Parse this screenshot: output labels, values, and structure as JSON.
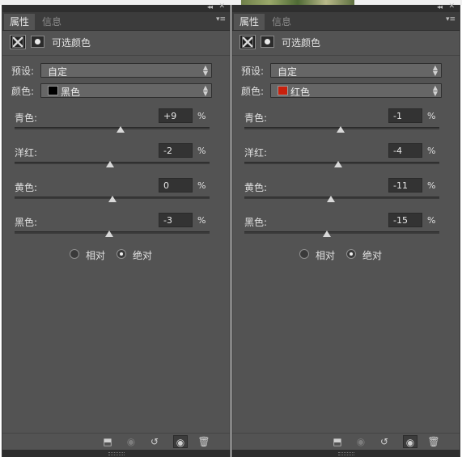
{
  "panels": [
    {
      "tabs": {
        "active": "属性",
        "inactive": "信息"
      },
      "window_controls": {
        "collapse": "◂◂",
        "close": "✕",
        "menu": "▾≡"
      },
      "title": "可选颜色",
      "preset_label": "预设:",
      "preset_value": "自定",
      "color_label": "颜色:",
      "color_value": "黑色",
      "color_swatch": "#000000",
      "sliders": [
        {
          "label": "青色:",
          "value": "+9",
          "unit": "%",
          "level": 9
        },
        {
          "label": "洋红:",
          "value": "-2",
          "unit": "%",
          "level": -2
        },
        {
          "label": "黄色:",
          "value": "0",
          "unit": "%",
          "level": 0
        },
        {
          "label": "黑色:",
          "value": "-3",
          "unit": "%",
          "level": -3
        }
      ],
      "methods": {
        "relative": "相对",
        "absolute": "绝对",
        "selected": "absolute"
      },
      "bottom_icons": [
        "clip-to-layer-icon",
        "view-previous-icon",
        "reset-icon",
        "visibility-eye-icon",
        "trash-icon"
      ]
    },
    {
      "tabs": {
        "active": "属性",
        "inactive": "信息"
      },
      "window_controls": {
        "collapse": "◂◂",
        "close": "✕",
        "menu": "▾≡"
      },
      "title": "可选颜色",
      "preset_label": "预设:",
      "preset_value": "自定",
      "color_label": "颜色:",
      "color_value": "红色",
      "color_swatch": "#c8200c",
      "sliders": [
        {
          "label": "青色:",
          "value": "-1",
          "unit": "%",
          "level": -1
        },
        {
          "label": "洋红:",
          "value": "-4",
          "unit": "%",
          "level": -4
        },
        {
          "label": "黄色:",
          "value": "-11",
          "unit": "%",
          "level": -11
        },
        {
          "label": "黑色:",
          "value": "-15",
          "unit": "%",
          "level": -15
        }
      ],
      "methods": {
        "relative": "相对",
        "absolute": "绝对",
        "selected": "absolute"
      },
      "bottom_icons": [
        "clip-to-layer-icon",
        "view-previous-icon",
        "reset-icon",
        "visibility-eye-icon",
        "trash-icon"
      ]
    }
  ],
  "colors": {
    "panel_bg": "#535353",
    "dock_bg": "#2e2e2e",
    "accent_text": "#e0e0e0"
  }
}
